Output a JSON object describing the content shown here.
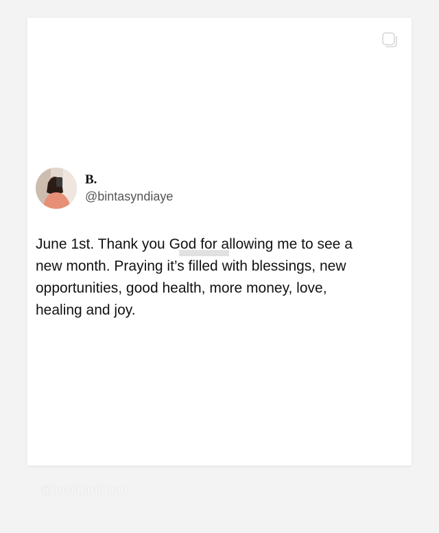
{
  "post": {
    "display_name": "B.",
    "handle": "@bintasyndiaye",
    "text": "June 1st. Thank you God for allowing me to see a\nnew month. Praying it’s filled with blessings, new\nopportunities, good health, more money, love,\nhealing and joy."
  },
  "icons": {
    "copy": "copy-icon",
    "avatar": "avatar"
  },
  "watermarks": {
    "bottom": "@bossbarbieem"
  },
  "colors": {
    "background": "#f3f3f3",
    "card": "#ffffff",
    "text": "#111111",
    "handle": "#545454"
  }
}
